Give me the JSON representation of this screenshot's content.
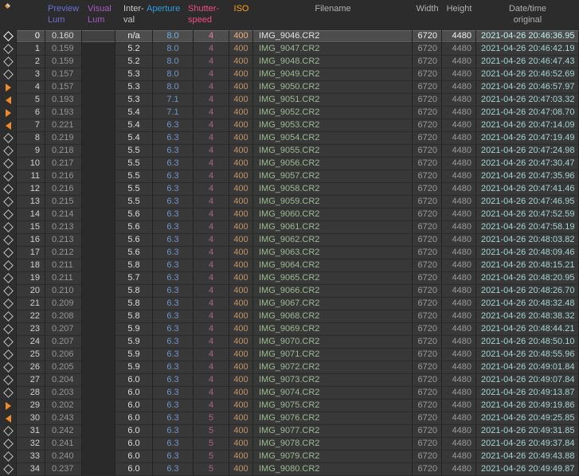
{
  "accent_colors": {
    "marker_orange": "#f08a28",
    "selected_row_bg": "#4d4d4d",
    "aperture_blue": "#6f95c8",
    "shutter_pink": "#b3608e",
    "iso_orange": "#c0945e",
    "filename_green": "#9cba92",
    "datetime_cyan": "#a3d6d4"
  },
  "table": {
    "columns": [
      {
        "id": "keyframe",
        "label_lines": [],
        "color": "#b0b0b0",
        "icon": "keyframe-diamond"
      },
      {
        "id": "index",
        "label_lines": [],
        "color": "#b0b0b0"
      },
      {
        "id": "preview_lum",
        "label_lines": [
          "Preview",
          "Lum"
        ],
        "color": "#6a6fd6"
      },
      {
        "id": "visual_lum",
        "label_lines": [
          "Visual",
          "Lum"
        ],
        "color": "#a958c8"
      },
      {
        "id": "interval",
        "label_lines": [
          "Inter-",
          "val"
        ],
        "color": "#c8c8c8"
      },
      {
        "id": "aperture",
        "label_lines": [
          "Aperture"
        ],
        "color": "#2d9de0"
      },
      {
        "id": "shutter",
        "label_lines": [
          "Shutter-",
          "speed"
        ],
        "color": "#ef4d86"
      },
      {
        "id": "iso",
        "label_lines": [
          "ISO"
        ],
        "color": "#ffa318"
      },
      {
        "id": "filename",
        "label_lines": [
          "Filename"
        ],
        "color": "#b0b0b0"
      },
      {
        "id": "width",
        "label_lines": [
          "Width"
        ],
        "color": "#b0b0b0"
      },
      {
        "id": "height",
        "label_lines": [
          "Height"
        ],
        "color": "#b0b0b0"
      },
      {
        "id": "datetime",
        "label_lines": [
          "Date/time",
          "original"
        ],
        "color": "#b0b0b0"
      }
    ],
    "rows": [
      {
        "marker": "diamond",
        "index": "0",
        "preview_lum": "0.160",
        "visual_lum": "",
        "interval": "n/a",
        "aperture": "8.0",
        "shutter": "4",
        "iso": "400",
        "filename": "IMG_9046.CR2",
        "width": "6720",
        "height": "4480",
        "datetime": "2021-04-26 20:46:36.95",
        "selected": true
      },
      {
        "marker": "diamond",
        "index": "1",
        "preview_lum": "0.159",
        "visual_lum": "",
        "interval": "5.2",
        "aperture": "8.0",
        "shutter": "4",
        "iso": "400",
        "filename": "IMG_9047.CR2",
        "width": "6720",
        "height": "4480",
        "datetime": "2021-04-26 20:46:42.19"
      },
      {
        "marker": "diamond",
        "index": "2",
        "preview_lum": "0.159",
        "visual_lum": "",
        "interval": "5.2",
        "aperture": "8.0",
        "shutter": "4",
        "iso": "400",
        "filename": "IMG_9048.CR2",
        "width": "6720",
        "height": "4480",
        "datetime": "2021-04-26 20:46:47.43"
      },
      {
        "marker": "diamond",
        "index": "3",
        "preview_lum": "0.157",
        "visual_lum": "",
        "interval": "5.3",
        "aperture": "8.0",
        "shutter": "4",
        "iso": "400",
        "filename": "IMG_9049.CR2",
        "width": "6720",
        "height": "4480",
        "datetime": "2021-04-26 20:46:52.69"
      },
      {
        "marker": "triangle-right",
        "index": "4",
        "preview_lum": "0.157",
        "visual_lum": "",
        "interval": "5.3",
        "aperture": "8.0",
        "shutter": "4",
        "iso": "400",
        "filename": "IMG_9050.CR2",
        "width": "6720",
        "height": "4480",
        "datetime": "2021-04-26 20:46:57.97"
      },
      {
        "marker": "triangle-left",
        "index": "5",
        "preview_lum": "0.193",
        "visual_lum": "",
        "interval": "5.3",
        "aperture": "7.1",
        "shutter": "4",
        "iso": "400",
        "filename": "IMG_9051.CR2",
        "width": "6720",
        "height": "4480",
        "datetime": "2021-04-26 20:47:03.32"
      },
      {
        "marker": "triangle-right",
        "index": "6",
        "preview_lum": "0.193",
        "visual_lum": "",
        "interval": "5.4",
        "aperture": "7.1",
        "shutter": "4",
        "iso": "400",
        "filename": "IMG_9052.CR2",
        "width": "6720",
        "height": "4480",
        "datetime": "2021-04-26 20:47:08.70"
      },
      {
        "marker": "triangle-left",
        "index": "7",
        "preview_lum": "0.221",
        "visual_lum": "",
        "interval": "5.4",
        "aperture": "6.3",
        "shutter": "4",
        "iso": "400",
        "filename": "IMG_9053.CR2",
        "width": "6720",
        "height": "4480",
        "datetime": "2021-04-26 20:47:14.09"
      },
      {
        "marker": "diamond",
        "index": "8",
        "preview_lum": "0.219",
        "visual_lum": "",
        "interval": "5.4",
        "aperture": "6.3",
        "shutter": "4",
        "iso": "400",
        "filename": "IMG_9054.CR2",
        "width": "6720",
        "height": "4480",
        "datetime": "2021-04-26 20:47:19.49"
      },
      {
        "marker": "diamond",
        "index": "9",
        "preview_lum": "0.218",
        "visual_lum": "",
        "interval": "5.5",
        "aperture": "6.3",
        "shutter": "4",
        "iso": "400",
        "filename": "IMG_9055.CR2",
        "width": "6720",
        "height": "4480",
        "datetime": "2021-04-26 20:47:24.98"
      },
      {
        "marker": "diamond",
        "index": "10",
        "preview_lum": "0.217",
        "visual_lum": "",
        "interval": "5.5",
        "aperture": "6.3",
        "shutter": "4",
        "iso": "400",
        "filename": "IMG_9056.CR2",
        "width": "6720",
        "height": "4480",
        "datetime": "2021-04-26 20:47:30.47"
      },
      {
        "marker": "diamond",
        "index": "11",
        "preview_lum": "0.216",
        "visual_lum": "",
        "interval": "5.5",
        "aperture": "6.3",
        "shutter": "4",
        "iso": "400",
        "filename": "IMG_9057.CR2",
        "width": "6720",
        "height": "4480",
        "datetime": "2021-04-26 20:47:35.96"
      },
      {
        "marker": "diamond",
        "index": "12",
        "preview_lum": "0.216",
        "visual_lum": "",
        "interval": "5.5",
        "aperture": "6.3",
        "shutter": "4",
        "iso": "400",
        "filename": "IMG_9058.CR2",
        "width": "6720",
        "height": "4480",
        "datetime": "2021-04-26 20:47:41.46"
      },
      {
        "marker": "diamond",
        "index": "13",
        "preview_lum": "0.215",
        "visual_lum": "",
        "interval": "5.5",
        "aperture": "6.3",
        "shutter": "4",
        "iso": "400",
        "filename": "IMG_9059.CR2",
        "width": "6720",
        "height": "4480",
        "datetime": "2021-04-26 20:47:46.95"
      },
      {
        "marker": "diamond",
        "index": "14",
        "preview_lum": "0.214",
        "visual_lum": "",
        "interval": "5.6",
        "aperture": "6.3",
        "shutter": "4",
        "iso": "400",
        "filename": "IMG_9060.CR2",
        "width": "6720",
        "height": "4480",
        "datetime": "2021-04-26 20:47:52.59"
      },
      {
        "marker": "diamond",
        "index": "15",
        "preview_lum": "0.213",
        "visual_lum": "",
        "interval": "5.6",
        "aperture": "6.3",
        "shutter": "4",
        "iso": "400",
        "filename": "IMG_9061.CR2",
        "width": "6720",
        "height": "4480",
        "datetime": "2021-04-26 20:47:58.19"
      },
      {
        "marker": "diamond",
        "index": "16",
        "preview_lum": "0.213",
        "visual_lum": "",
        "interval": "5.6",
        "aperture": "6.3",
        "shutter": "4",
        "iso": "400",
        "filename": "IMG_9062.CR2",
        "width": "6720",
        "height": "4480",
        "datetime": "2021-04-26 20:48:03.82"
      },
      {
        "marker": "diamond",
        "index": "17",
        "preview_lum": "0.212",
        "visual_lum": "",
        "interval": "5.6",
        "aperture": "6.3",
        "shutter": "4",
        "iso": "400",
        "filename": "IMG_9063.CR2",
        "width": "6720",
        "height": "4480",
        "datetime": "2021-04-26 20:48:09.46"
      },
      {
        "marker": "diamond",
        "index": "18",
        "preview_lum": "0.211",
        "visual_lum": "",
        "interval": "5.8",
        "aperture": "6.3",
        "shutter": "4",
        "iso": "400",
        "filename": "IMG_9064.CR2",
        "width": "6720",
        "height": "4480",
        "datetime": "2021-04-26 20:48:15.21"
      },
      {
        "marker": "diamond",
        "index": "19",
        "preview_lum": "0.211",
        "visual_lum": "",
        "interval": "5.7",
        "aperture": "6.3",
        "shutter": "4",
        "iso": "400",
        "filename": "IMG_9065.CR2",
        "width": "6720",
        "height": "4480",
        "datetime": "2021-04-26 20:48:20.95"
      },
      {
        "marker": "diamond",
        "index": "20",
        "preview_lum": "0.210",
        "visual_lum": "",
        "interval": "5.8",
        "aperture": "6.3",
        "shutter": "4",
        "iso": "400",
        "filename": "IMG_9066.CR2",
        "width": "6720",
        "height": "4480",
        "datetime": "2021-04-26 20:48:26.70"
      },
      {
        "marker": "diamond",
        "index": "21",
        "preview_lum": "0.209",
        "visual_lum": "",
        "interval": "5.8",
        "aperture": "6.3",
        "shutter": "4",
        "iso": "400",
        "filename": "IMG_9067.CR2",
        "width": "6720",
        "height": "4480",
        "datetime": "2021-04-26 20:48:32.48"
      },
      {
        "marker": "diamond",
        "index": "22",
        "preview_lum": "0.208",
        "visual_lum": "",
        "interval": "5.8",
        "aperture": "6.3",
        "shutter": "4",
        "iso": "400",
        "filename": "IMG_9068.CR2",
        "width": "6720",
        "height": "4480",
        "datetime": "2021-04-26 20:48:38.32"
      },
      {
        "marker": "diamond",
        "index": "23",
        "preview_lum": "0.207",
        "visual_lum": "",
        "interval": "5.9",
        "aperture": "6.3",
        "shutter": "4",
        "iso": "400",
        "filename": "IMG_9069.CR2",
        "width": "6720",
        "height": "4480",
        "datetime": "2021-04-26 20:48:44.21"
      },
      {
        "marker": "diamond",
        "index": "24",
        "preview_lum": "0.207",
        "visual_lum": "",
        "interval": "5.9",
        "aperture": "6.3",
        "shutter": "4",
        "iso": "400",
        "filename": "IMG_9070.CR2",
        "width": "6720",
        "height": "4480",
        "datetime": "2021-04-26 20:48:50.10"
      },
      {
        "marker": "diamond",
        "index": "25",
        "preview_lum": "0.206",
        "visual_lum": "",
        "interval": "5.9",
        "aperture": "6.3",
        "shutter": "4",
        "iso": "400",
        "filename": "IMG_9071.CR2",
        "width": "6720",
        "height": "4480",
        "datetime": "2021-04-26 20:48:55.96"
      },
      {
        "marker": "diamond",
        "index": "26",
        "preview_lum": "0.205",
        "visual_lum": "",
        "interval": "5.9",
        "aperture": "6.3",
        "shutter": "4",
        "iso": "400",
        "filename": "IMG_9072.CR2",
        "width": "6720",
        "height": "4480",
        "datetime": "2021-04-26 20:49:01.84"
      },
      {
        "marker": "diamond",
        "index": "27",
        "preview_lum": "0.204",
        "visual_lum": "",
        "interval": "6.0",
        "aperture": "6.3",
        "shutter": "4",
        "iso": "400",
        "filename": "IMG_9073.CR2",
        "width": "6720",
        "height": "4480",
        "datetime": "2021-04-26 20:49:07.84"
      },
      {
        "marker": "diamond",
        "index": "28",
        "preview_lum": "0.203",
        "visual_lum": "",
        "interval": "6.0",
        "aperture": "6.3",
        "shutter": "4",
        "iso": "400",
        "filename": "IMG_9074.CR2",
        "width": "6720",
        "height": "4480",
        "datetime": "2021-04-26 20:49:13.87"
      },
      {
        "marker": "triangle-right",
        "index": "29",
        "preview_lum": "0.202",
        "visual_lum": "",
        "interval": "6.0",
        "aperture": "6.3",
        "shutter": "4",
        "iso": "400",
        "filename": "IMG_9075.CR2",
        "width": "6720",
        "height": "4480",
        "datetime": "2021-04-26 20:49:19.86"
      },
      {
        "marker": "triangle-left",
        "index": "30",
        "preview_lum": "0.243",
        "visual_lum": "",
        "interval": "6.0",
        "aperture": "6.3",
        "shutter": "5",
        "iso": "400",
        "filename": "IMG_9076.CR2",
        "width": "6720",
        "height": "4480",
        "datetime": "2021-04-26 20:49:25.85"
      },
      {
        "marker": "diamond",
        "index": "31",
        "preview_lum": "0.242",
        "visual_lum": "",
        "interval": "6.0",
        "aperture": "6.3",
        "shutter": "5",
        "iso": "400",
        "filename": "IMG_9077.CR2",
        "width": "6720",
        "height": "4480",
        "datetime": "2021-04-26 20:49:31.85"
      },
      {
        "marker": "diamond",
        "index": "32",
        "preview_lum": "0.241",
        "visual_lum": "",
        "interval": "6.0",
        "aperture": "6.3",
        "shutter": "5",
        "iso": "400",
        "filename": "IMG_9078.CR2",
        "width": "6720",
        "height": "4480",
        "datetime": "2021-04-26 20:49:37.84"
      },
      {
        "marker": "diamond",
        "index": "33",
        "preview_lum": "0.240",
        "visual_lum": "",
        "interval": "6.0",
        "aperture": "6.3",
        "shutter": "5",
        "iso": "400",
        "filename": "IMG_9079.CR2",
        "width": "6720",
        "height": "4480",
        "datetime": "2021-04-26 20:49:43.88"
      },
      {
        "marker": "diamond",
        "index": "34",
        "preview_lum": "0.237",
        "visual_lum": "",
        "interval": "6.0",
        "aperture": "6.3",
        "shutter": "5",
        "iso": "400",
        "filename": "IMG_9080.CR2",
        "width": "6720",
        "height": "4480",
        "datetime": "2021-04-26 20:49:49.87"
      }
    ]
  }
}
